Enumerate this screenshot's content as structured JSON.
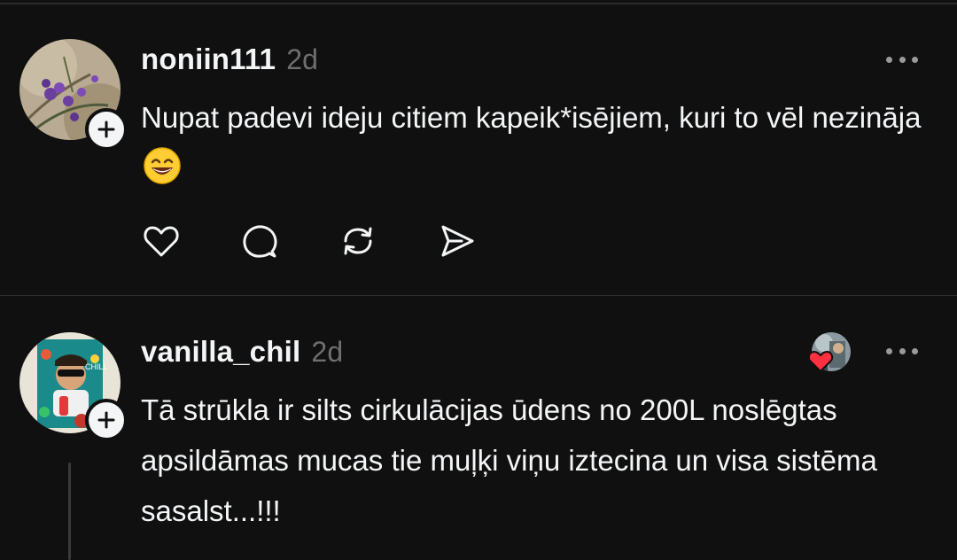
{
  "posts": [
    {
      "username": "noniin111",
      "time": "2d",
      "text": "Nupat padevi ideju citiem kapeik*isējiem, kuri to vēl nezināja",
      "emoji": "grinning-face-with-smiling-eyes"
    },
    {
      "username": "vanilla_chil",
      "time": "2d",
      "text": "Tā strūkla ir silts  cirkulācijas ūdens no 200L noslēgtas apsildāmas  mucas  tie muļķi viņu iztecina un visa sistēma sasalst...!!!"
    }
  ],
  "icons": {
    "like": "heart-outline-icon",
    "reply": "comment-bubble-icon",
    "repost": "repost-icon",
    "share": "send-icon",
    "more": "more-dots-icon",
    "follow": "plus-icon",
    "liked_by": "red-heart-icon"
  },
  "colors": {
    "background": "#101010",
    "text": "#f3f5f7",
    "secondary": "#6f6f6f",
    "like_red": "#ff3040"
  }
}
